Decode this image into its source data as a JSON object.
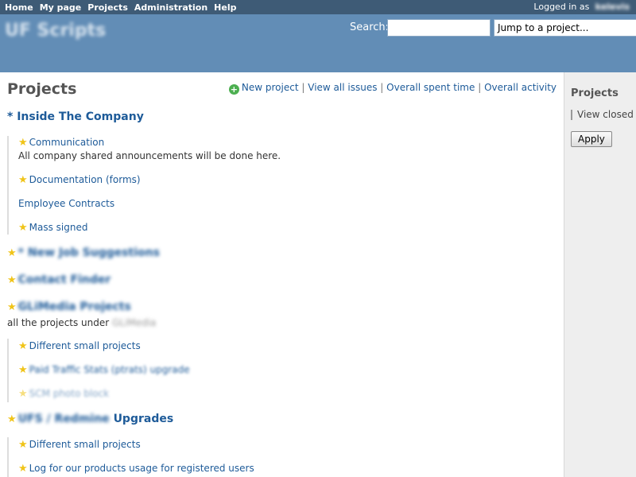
{
  "top_menu": {
    "items": [
      "Home",
      "My page",
      "Projects",
      "Administration",
      "Help"
    ],
    "logged_label": "Logged in as",
    "user": "kelevis"
  },
  "header": {
    "site_title": "UF Scripts",
    "search_label": "Search:",
    "search_value": "",
    "jump_label": "Jump to a project..."
  },
  "main": {
    "title": "Projects",
    "contextual": {
      "new_project": "New project",
      "view_all_issues": "View all issues",
      "overall_spent_time": "Overall spent time",
      "overall_activity": "Overall activity",
      "separator": "|"
    },
    "projects": {
      "p1": {
        "name": "* Inside The Company"
      },
      "p1_children": [
        {
          "name": "Communication",
          "desc": "All company shared announcements will be done here."
        },
        {
          "name": "Documentation (forms)"
        },
        {
          "name": "Employee Contracts"
        },
        {
          "name": "Mass signed"
        }
      ],
      "p2": {
        "name": "* New Job Suggestions"
      },
      "p3": {
        "name": "Contact Finder"
      },
      "p4": {
        "name": "GLiMedia Projects",
        "desc": "all the projects under",
        "desc_blur": "GLiMedia"
      },
      "p4_children": [
        {
          "name": "Different small projects"
        },
        {
          "name": "Paid Traffic Stats (ptrats) upgrade"
        },
        {
          "name": "SCM photo block"
        }
      ],
      "p5": {
        "name_blur": "UFS / Redmine",
        "name": "Upgrades"
      },
      "p5_children": [
        {
          "name": "Different small projects"
        },
        {
          "name": "Log for our products usage for registered users"
        }
      ]
    }
  },
  "sidebar": {
    "title": "Projects",
    "view_closed": "View closed projects",
    "apply": "Apply"
  },
  "colors": {
    "top_menu_bg": "#3e5b76",
    "header_bg": "#628db6",
    "link": "#1e5b99",
    "star": "#f0c419",
    "sidebar_bg": "#eeeeee"
  }
}
